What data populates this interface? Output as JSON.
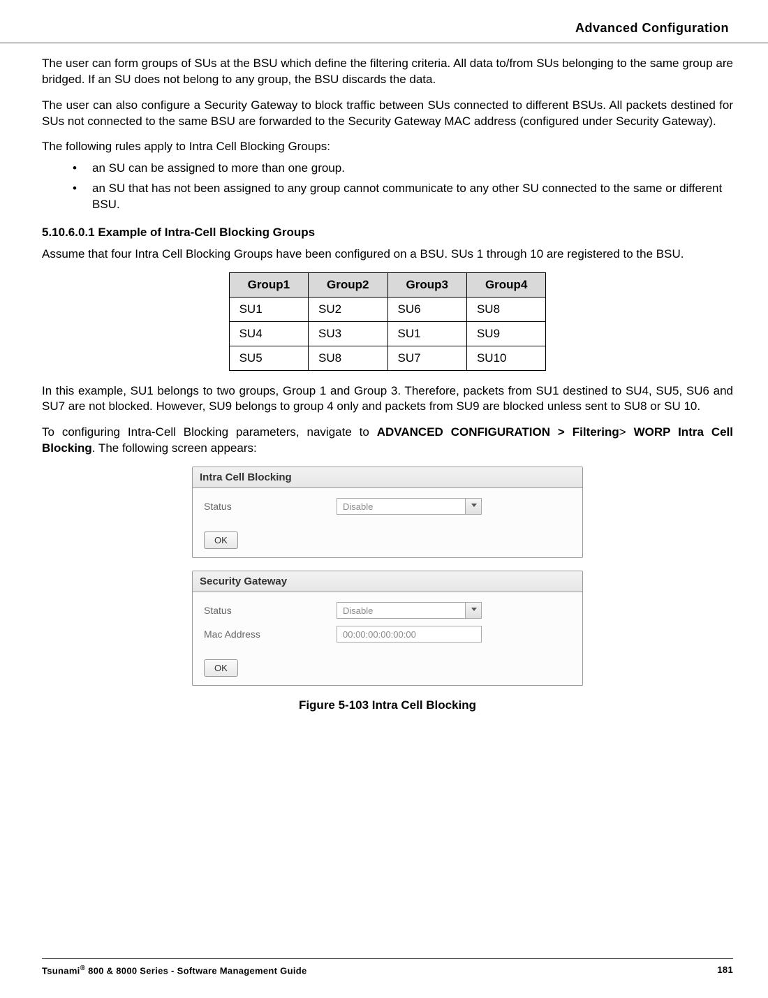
{
  "header": {
    "title": "Advanced Configuration"
  },
  "para1": "The user can form groups of SUs at the BSU which define the filtering criteria. All data to/from SUs belonging to the same group are bridged. If an SU does not belong to any group, the BSU discards the data.",
  "para2": "The user can also configure a Security Gateway to block traffic between SUs connected to different BSUs. All packets destined for SUs not connected to the same BSU are forwarded to the Security Gateway MAC address (configured under Security Gateway).",
  "para3": "The following rules apply to Intra Cell Blocking Groups:",
  "rules": [
    "an SU can be assigned to more than one group.",
    "an SU that has not been assigned to any group cannot communicate to any other SU connected to the same or different BSU."
  ],
  "subhead": "5.10.6.0.1 Example of Intra-Cell Blocking Groups",
  "para4": "Assume that four Intra Cell Blocking Groups have been configured on a BSU. SUs 1 through 10 are registered to the BSU.",
  "table": {
    "headers": [
      "Group1",
      "Group2",
      "Group3",
      "Group4"
    ],
    "rows": [
      [
        "SU1",
        "SU2",
        "SU6",
        "SU8"
      ],
      [
        "SU4",
        "SU3",
        "SU1",
        "SU9"
      ],
      [
        "SU5",
        "SU8",
        "SU7",
        "SU10"
      ]
    ]
  },
  "para5": "In this example, SU1 belongs to two groups, Group 1 and Group 3. Therefore, packets from SU1 destined to SU4, SU5, SU6 and SU7 are not blocked. However, SU9 belongs to group 4 only and packets from SU9 are blocked unless sent to SU8 or SU 10.",
  "para6_pre": "To configuring Intra-Cell Blocking parameters, navigate to ",
  "para6_nav1": "ADVANCED CONFIGURATION > Filtering",
  "para6_mid": "> ",
  "para6_nav2": "WORP Intra Cell Blocking",
  "para6_post": ". The following screen appears:",
  "panel1": {
    "title": "Intra Cell Blocking",
    "status_label": "Status",
    "status_value": "Disable",
    "ok": "OK"
  },
  "panel2": {
    "title": "Security Gateway",
    "status_label": "Status",
    "status_value": "Disable",
    "mac_label": "Mac Address",
    "mac_value": "00:00:00:00:00:00",
    "ok": "OK"
  },
  "figcaption": "Figure 5-103 Intra Cell Blocking",
  "footer": {
    "left_pre": "Tsunami",
    "left_reg": "®",
    "left_post": " 800 & 8000 Series - Software Management Guide",
    "page": "181"
  }
}
